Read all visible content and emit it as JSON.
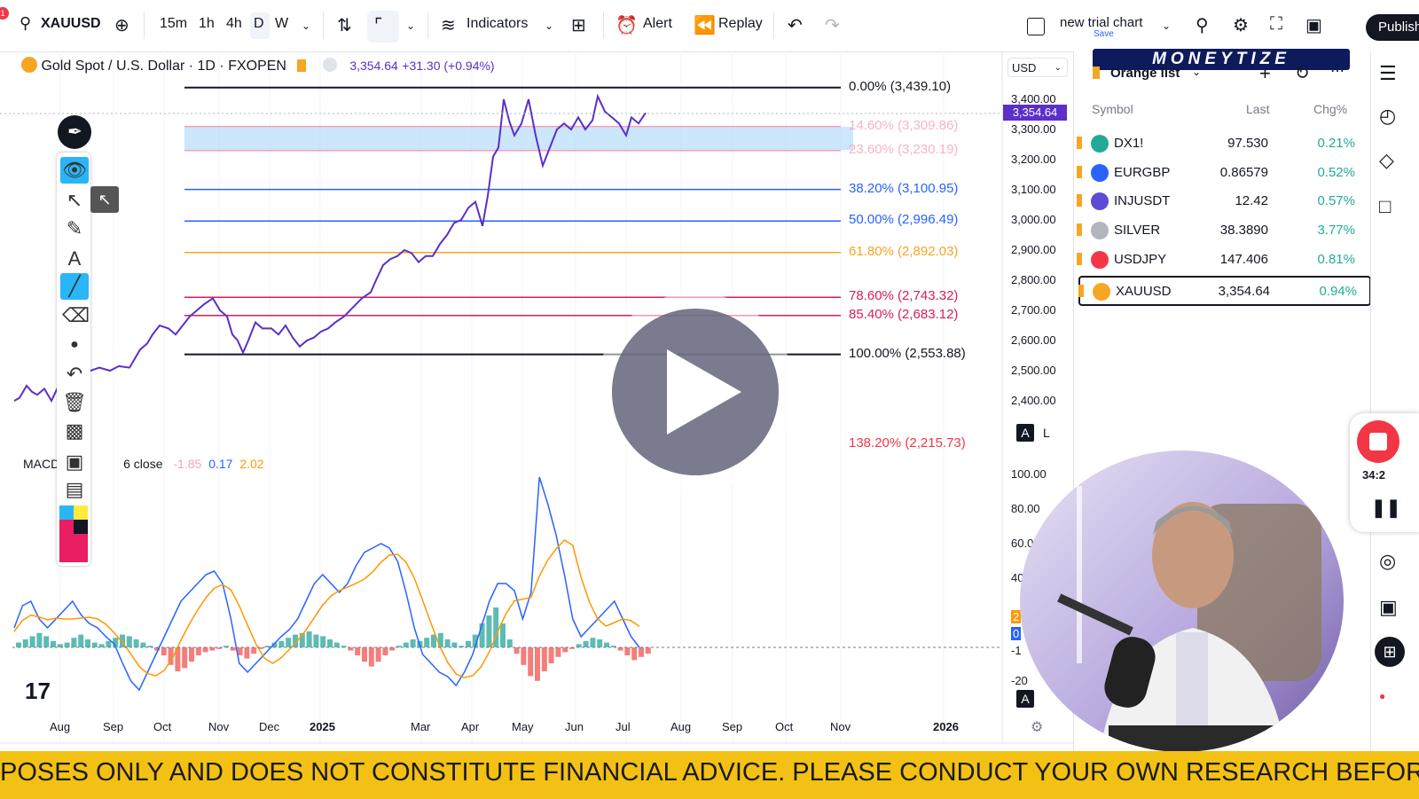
{
  "toolbar": {
    "symbol": "XAUUSD",
    "timeframes": [
      "15m",
      "1h",
      "4h",
      "D",
      "W"
    ],
    "indicators_label": "Indicators",
    "alert_label": "Alert",
    "replay_label": "Replay",
    "chart_name": "new trial chart",
    "chart_save": "Save",
    "publish_label": "Publish",
    "notification_count": "1"
  },
  "legend": {
    "title": "Gold Spot / U.S. Dollar · 1D · FXOPEN",
    "price": "3,354.64",
    "change": "+31.30 (+0.94%)"
  },
  "currency": "USD",
  "brand_banner": "MONEYTIZE",
  "fib_levels": [
    {
      "label": "0.00% (3,439.10)",
      "price": 3439.1,
      "color": "#131722"
    },
    {
      "label": "14.60% (3,309.86)",
      "price": 3309.86,
      "color": "#f7a1b5"
    },
    {
      "label": "23.60% (3,230.19)",
      "price": 3230.19,
      "color": "#f7a1b5"
    },
    {
      "label": "38.20% (3,100.95)",
      "price": 3100.95,
      "color": "#2962ff"
    },
    {
      "label": "50.00% (2,996.49)",
      "price": 2996.49,
      "color": "#2962ff"
    },
    {
      "label": "61.80% (2,892.03)",
      "price": 2892.03,
      "color": "#f5a623"
    },
    {
      "label": "78.60% (2,743.32)",
      "price": 2743.32,
      "color": "#d81b60"
    },
    {
      "label": "85.40% (2,683.12)",
      "price": 2683.12,
      "color": "#d81b60"
    },
    {
      "label": "100.00% (2,553.88)",
      "price": 2553.88,
      "color": "#131722"
    },
    {
      "label": "138.20% (2,215.73)",
      "price": 2215.73,
      "color": "#f23645"
    }
  ],
  "price_axis": [
    "3,400.00",
    "3,354.64",
    "3,300.00",
    "3,200.00",
    "3,100.00",
    "3,000.00",
    "2,900.00",
    "2,800.00",
    "2,700.00",
    "2,600.00",
    "2,500.00",
    "2,400.00"
  ],
  "current_price_tag": "3,354.64",
  "axis_mode": {
    "a": "A",
    "l": "L"
  },
  "macd": {
    "name": "MACD",
    "source": "6 close",
    "v1": "-1.85",
    "v2": "0.17",
    "v3": "2.02"
  },
  "macd_axis": [
    "100.00",
    "80.00",
    "60.0",
    "40",
    "2",
    "0",
    "-1",
    "-20"
  ],
  "time_axis": [
    "Aug",
    "Sep",
    "Oct",
    "Nov",
    "Dec",
    "2025",
    "Mar",
    "Apr",
    "May",
    "Jun",
    "Jul",
    "Aug",
    "Sep",
    "Oct",
    "Nov",
    "2026"
  ],
  "watchlist": {
    "title": "Orange list",
    "headers": {
      "symbol": "Symbol",
      "last": "Last",
      "chg": "Chg%"
    },
    "rows": [
      {
        "symbol": "DX1!",
        "last": "97.530",
        "chg": "0.21%",
        "icon_color": "#22ab94"
      },
      {
        "symbol": "EURGBP",
        "last": "0.86579",
        "chg": "0.52%",
        "icon_color": "#2962ff"
      },
      {
        "symbol": "INJUSDT",
        "last": "12.42",
        "chg": "0.57%",
        "icon_color": "#5b4bd5"
      },
      {
        "symbol": "SILVER",
        "last": "38.3890",
        "chg": "3.77%",
        "icon_color": "#b2b5be"
      },
      {
        "symbol": "USDJPY",
        "last": "147.406",
        "chg": "0.81%",
        "icon_color": "#f23645"
      },
      {
        "symbol": "XAUUSD",
        "last": "3,354.64",
        "chg": "0.94%",
        "icon_color": "#f5a623"
      }
    ]
  },
  "recorder": {
    "time": "34:2"
  },
  "ticker_text": "POSES ONLY AND DOES NOT CONSTITUTE FINANCIAL ADVICE. PLEASE CONDUCT YOUR OWN RESEARCH BEFORE MAKING ANY INVE"
}
